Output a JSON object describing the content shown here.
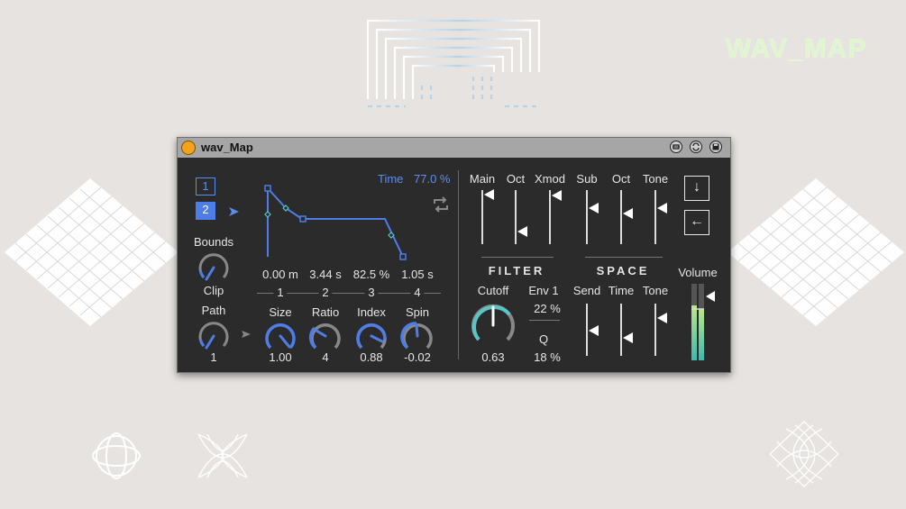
{
  "window": {
    "title": "wav_Map"
  },
  "brand": {
    "logo_text": "WAV_MAP"
  },
  "colors": {
    "accent_blue": "#4f7de8",
    "teal": "#59c6c6",
    "amber": "#f4a21d",
    "panel": "#2b2b2b"
  },
  "left": {
    "slot_1": "1",
    "slot_2": "2",
    "bounds_label": "Bounds",
    "clip_label": "Clip",
    "path_label": "Path",
    "path_value": "1"
  },
  "envelope": {
    "time_label": "Time",
    "time_value": "77.0 %",
    "segment_values": [
      "0.00 m",
      "3.44 s",
      "82.5 %",
      "1.05 s"
    ],
    "segment_numbers": [
      "1",
      "2",
      "3",
      "4"
    ]
  },
  "knobs": [
    {
      "label": "Size",
      "value": "1.00"
    },
    {
      "label": "Ratio",
      "value": "4"
    },
    {
      "label": "Index",
      "value": "0.88"
    },
    {
      "label": "Spin",
      "value": "-0.02"
    }
  ],
  "mixer": {
    "top_labels": [
      "Main",
      "Oct",
      "Xmod",
      "Sub",
      "Oct",
      "Tone"
    ],
    "filter": {
      "header": "FILTER",
      "cutoff_label": "Cutoff",
      "cutoff_value": "0.63",
      "env_label": "Env 1",
      "env_value": "22 %",
      "q_label": "Q",
      "q_value": "18 %"
    },
    "space": {
      "header": "SPACE",
      "labels": [
        "Send",
        "Time",
        "Tone"
      ]
    },
    "volume_label": "Volume"
  },
  "icons": [
    "record-icon",
    "swap-icon",
    "save-icon",
    "loop-icon",
    "play-arrow-icon",
    "down-arrow-icon",
    "left-arrow-icon"
  ]
}
